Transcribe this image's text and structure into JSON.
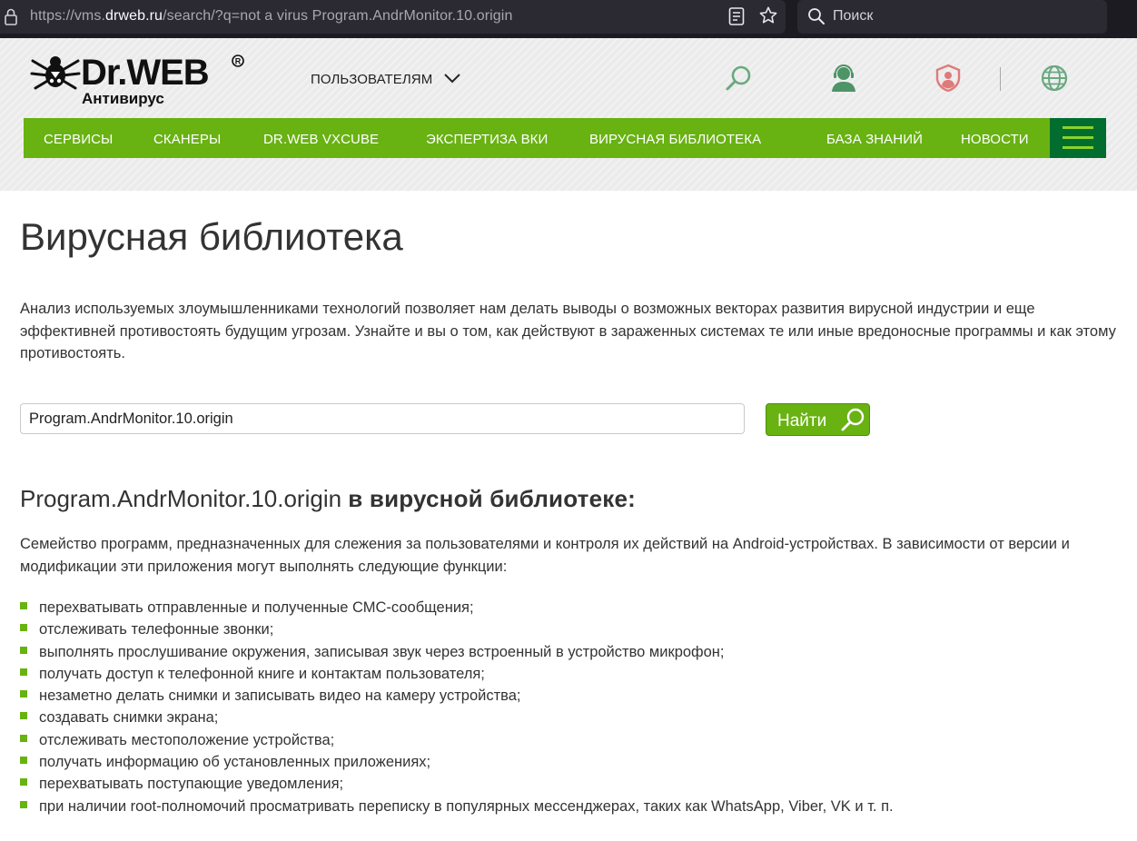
{
  "browser": {
    "url_prefix": "https://vms.",
    "url_host": "drweb.ru",
    "url_suffix": "/search/?q=not a virus Program.AndrMonitor.10.origin",
    "search_placeholder": "Поиск"
  },
  "header": {
    "logo_text": "Dr.WEB",
    "logo_subtitle": "Антивирус",
    "audience_label": "ПОЛЬЗОВАТЕЛЯМ",
    "icons": [
      "search-icon",
      "support-icon",
      "account-shield-icon",
      "globe-icon"
    ]
  },
  "nav": {
    "items": [
      {
        "label": "СЕРВИСЫ"
      },
      {
        "label": "СКАНЕРЫ"
      },
      {
        "label": "DR.WEB VXCUBE"
      },
      {
        "label": "ЭКСПЕРТИЗА ВКИ"
      },
      {
        "label": "ВИРУСНАЯ БИБЛИОТЕКА"
      },
      {
        "label": "БАЗА ЗНАНИЙ"
      },
      {
        "label": "НОВОСТИ"
      }
    ]
  },
  "main": {
    "title": "Вирусная библиотека",
    "intro": "Анализ используемых злоумышленниками технологий позволяет нам делать выводы о возможных векторах развития вирусной индустрии и еще эффективней противостоять будущим угрозам. Узнайте и вы о том, как действуют в зараженных системах те или иные вредоносные программы и как этому противостоять.",
    "search_value": "Program.AndrMonitor.10.origin",
    "search_button": "Найти",
    "result_name": "Program.AndrMonitor.10.origin",
    "result_suffix": "в вирусной библиотеке:",
    "description": "Семейство программ, предназначенных для слежения за пользователями и контроля их действий на Android-устройствах. В зависимости от версии и модификации эти приложения могут выполнять следующие функции:",
    "features": [
      "перехватывать отправленные и полученные СМС-сообщения;",
      "отслеживать телефонные звонки;",
      "выполнять прослушивание окружения, записывая звук через встроенный в устройство микрофон;",
      "получать доступ к телефонной книге и контактам пользователя;",
      "незаметно делать снимки и записывать видео на камеру устройства;",
      "создавать снимки экрана;",
      "отслеживать местоположение устройства;",
      "получать информацию об установленных приложениях;",
      "перехватывать поступающие уведомления;",
      "при наличии root-полномочий просматривать переписку в популярных мессенджерах, таких как WhatsApp, Viber, VK и т. п."
    ]
  },
  "colors": {
    "brand_green": "#68b212",
    "dark_green": "#016d2f",
    "accent_red": "#d9534f"
  }
}
